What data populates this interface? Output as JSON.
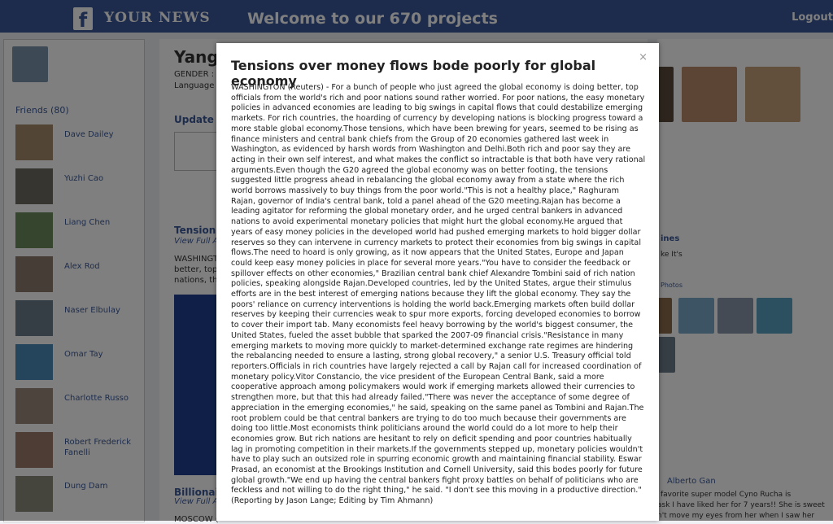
{
  "header": {
    "brand": "YOUR NEWS",
    "welcome": "Welcome to our 670 projects",
    "logout": "Logout"
  },
  "profile": {
    "name": "Yang",
    "gender_label": "GENDER :",
    "language_label": "Language",
    "update_status": "Update St"
  },
  "friends": {
    "heading": "Friends (80)",
    "items": [
      "Dave Dailey",
      "Yuzhi Cao",
      "Liang Chen",
      "Alex Rod",
      "Naser Elbulay",
      "Omar Tay",
      "Charlotte Russo",
      "Robert Frederick Fanelli",
      "Dung Dam"
    ]
  },
  "feed": {
    "item1_title": "Tensions",
    "item1_link": "View Full A",
    "item1_snippet": [
      "WASHINGT",
      "better, top",
      "nations, th"
    ],
    "item2_title": "Billionaire",
    "item2_link": "View Full A",
    "item2_snippet": "MOSCOW ("
  },
  "right": {
    "link1": "ines",
    "text1": "ke It's",
    "label": "Photos",
    "friend": "Alberto Gan",
    "snippet": [
      "favorite super model Cyno Rucha is",
      "ask I have liked her for 7 years!! She is sweet",
      "n't move my eyes from her when I saw her"
    ]
  },
  "modal": {
    "title": "Tensions over money flows bode poorly for global economy",
    "close": "×",
    "body": "WASHINGTON (Reuters) - For a bunch of people who just agreed the global economy is doing better, top officials from the world's rich and poor nations sound rather worried. For poor nations, the easy monetary policies in advanced economies are leading to big swings in capital flows that could destabilize emerging markets. For rich countries, the hoarding of currency by developing nations is blocking progress toward a more stable global economy.Those tensions, which have been brewing for years, seemed to be rising as finance ministers and central bank chiefs from the Group of 20 economies gathered last week in Washington, as evidenced by harsh words from Washington and Delhi.Both rich and poor say they are acting in their own self interest, and what makes the conflict so intractable is that both have very rational arguments.Even though the G20 agreed the global economy was on better footing, the tensions suggested little progress ahead in rebalancing the global economy away from a state where the rich world borrows massively to buy things from the poor world.\"This is not a healthy place,\" Raghuram Rajan, governor of India's central bank, told a panel ahead of the G20 meeting.Rajan has become a leading agitator for reforming the global monetary order, and he urged central bankers in advanced nations to avoid experimental monetary policies that might hurt the global economy.He argued that years of easy money policies in the developed world had pushed emerging markets to hold bigger dollar reserves so they can intervene in currency markets to protect their economies from big swings in capital flows.The need to hoard is only growing, as it now appears that the United States, Europe and Japan could keep easy money policies in place for several more years.\"You have to consider the feedback or spillover effects on other economies,\" Brazilian central bank chief Alexandre Tombini said of rich nation policies, speaking alongside Rajan.Developed countries, led by the United States, argue their stimulus efforts are in the best interest of emerging nations because they lift the global economy. They say the poors' reliance on currency interventions is holding the world back.Emerging markets often build dollar reserves by keeping their currencies weak to spur more exports, forcing developed economies to borrow to cover their import tab. Many economists feel heavy borrowing by the world's biggest consumer, the United States, fueled the asset bubble that sparked the 2007-09 financial crisis.\"Resistance in many emerging markets to moving more quickly to market-determined exchange rate regimes are hindering the rebalancing needed to ensure a lasting, strong global recovery,\" a senior U.S. Treasury official told reporters.Officials in rich countries have largely rejected a call by Rajan call for increased coordination of monetary policy.Vitor Constancio, the vice president of the European Central Bank, said a more cooperative approach among policymakers would work if emerging markets allowed their currencies to strengthen more, but that this had already failed.\"There was never the acceptance of some degree of appreciation in the emerging economies,\" he said, speaking on the same panel as Tombini and Rajan.The root problem could be that central bankers are trying to do too much because their governments are doing too little.Most economists think politicians around the world could do a lot more to help their economies grow. But rich nations are hesitant to rely on deficit spending and poor countries habitually lag in promoting competition in their markets.If the governments stepped up, monetary policies wouldn't have to play such an outsized role in spurring economic growth and maintaining financial stability. Eswar Prasad, an economist at the Brookings Institution and Cornell University, said this bodes poorly for future global growth.\"We end up having the central bankers fight proxy battles on behalf of politicians who are feckless and not willing to do the right thing,\" he said. \"I don't see this moving in a productive direction.\"(Reporting by Jason Lange; Editing by Tim Ahmann)"
  }
}
